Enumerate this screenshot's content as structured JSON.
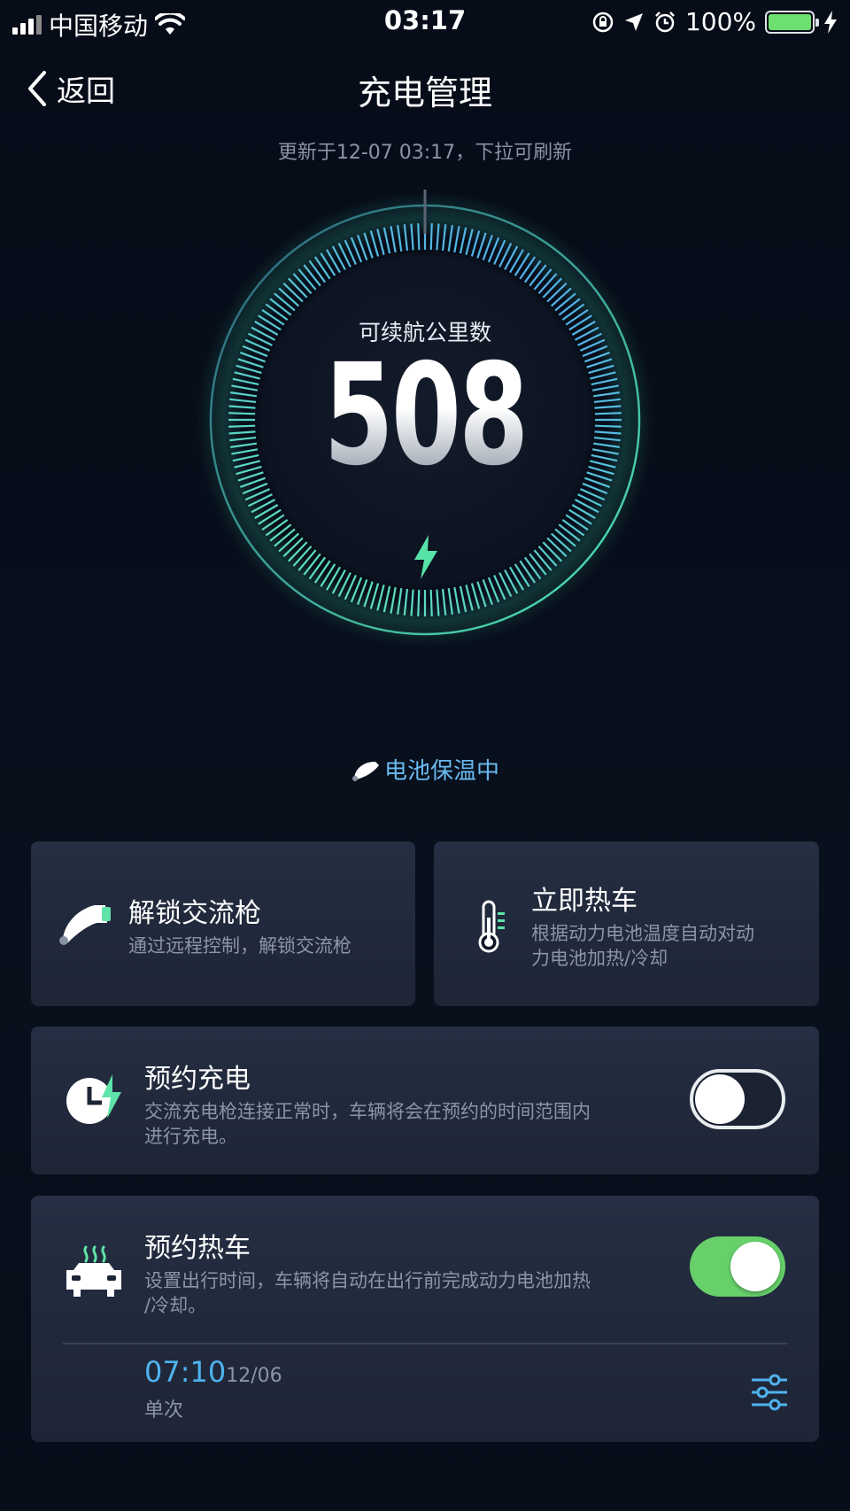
{
  "status_bar": {
    "carrier": "中国移动",
    "time": "03:17",
    "battery": "100%"
  },
  "nav": {
    "back_label": "返回",
    "title": "充电管理"
  },
  "update_text": "更新于12-07 03:17，下拉可刷新",
  "gauge": {
    "label": "可续航公里数",
    "value": "508"
  },
  "battery_status": "电池保温中",
  "cards": {
    "unlock": {
      "title": "解锁交流枪",
      "desc": "通过远程控制，解锁交流枪"
    },
    "heat_now": {
      "title": "立即热车",
      "desc_line1": "根据动力电池温度自动对动",
      "desc_line2": "力电池加热/冷却"
    },
    "schedule_charge": {
      "title": "预约充电",
      "desc_line1": "交流充电枪连接正常时，车辆将会在预约的时间范围内",
      "desc_line2": "进行充电。",
      "enabled": false
    },
    "schedule_heat": {
      "title": "预约热车",
      "desc_line1": "设置出行时间，车辆将自动在出行前完成动力电池加热",
      "desc_line2": "/冷却。",
      "enabled": true,
      "time": "07:10",
      "date": "12/06",
      "repeat": "单次"
    }
  },
  "colors": {
    "accent_blue": "#4fb3ee",
    "accent_green": "#5fe3a8",
    "toggle_on": "#67d06a"
  }
}
